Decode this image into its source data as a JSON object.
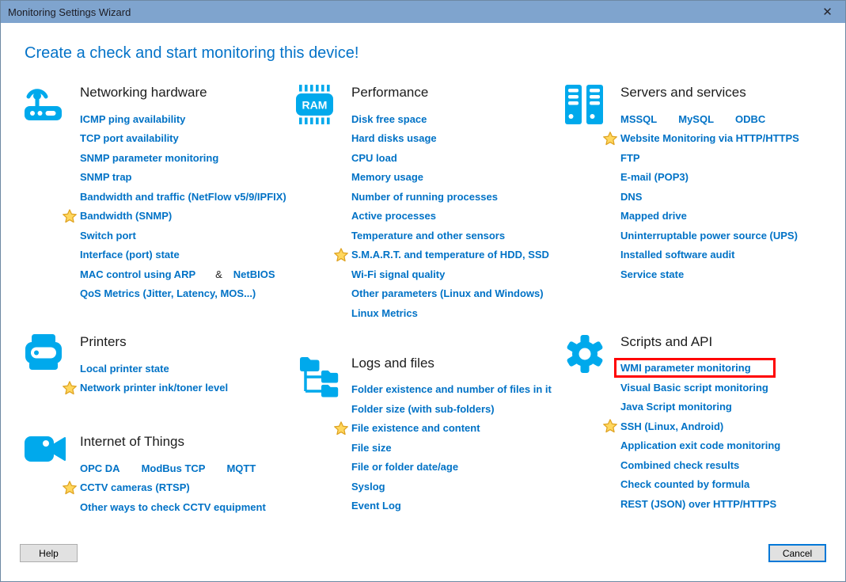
{
  "window": {
    "title": "Monitoring Settings Wizard",
    "close_glyph": "✕"
  },
  "heading": "Create a check and start monitoring this device!",
  "colors": {
    "icon_blue": "#00a9ec",
    "link_blue": "#0072c6",
    "titlebar_blue": "#7fa4ce",
    "heading_blue": "#0473c8",
    "highlight_red": "#ff0000",
    "star_gold": "#ffd75e"
  },
  "footer": {
    "help_label": "Help",
    "cancel_label": "Cancel"
  },
  "columns": [
    {
      "sections": [
        {
          "icon": "router-icon",
          "title": "Networking hardware",
          "items": [
            {
              "label": "ICMP ping availability"
            },
            {
              "label": "TCP port availability"
            },
            {
              "label": "SNMP parameter monitoring"
            },
            {
              "label": "SNMP trap"
            },
            {
              "label": "Bandwidth and traffic (NetFlow v5/9/IPFIX)"
            },
            {
              "label": "Bandwidth (SNMP)",
              "star": true
            },
            {
              "label": "Switch port"
            },
            {
              "label": "Interface (port) state"
            },
            {
              "links": [
                "MAC control using ARP",
                "NetBIOS"
              ],
              "separator": "&"
            },
            {
              "label": "QoS Metrics (Jitter, Latency, MOS...)"
            }
          ]
        },
        {
          "icon": "printer-icon",
          "title": "Printers",
          "items": [
            {
              "label": "Local printer state"
            },
            {
              "label": "Network printer ink/toner level",
              "star": true
            }
          ]
        },
        {
          "icon": "camera-icon",
          "title": "Internet of Things",
          "items": [
            {
              "links": [
                "OPC DA",
                "ModBus TCP",
                "MQTT"
              ]
            },
            {
              "label": "CCTV cameras (RTSP)",
              "star": true
            },
            {
              "label": "Other ways to check CCTV equipment"
            }
          ]
        }
      ]
    },
    {
      "sections": [
        {
          "icon": "ram-icon",
          "title": "Performance",
          "items": [
            {
              "label": "Disk free space"
            },
            {
              "label": "Hard disks usage"
            },
            {
              "label": "CPU load"
            },
            {
              "label": "Memory usage"
            },
            {
              "label": "Number of running processes"
            },
            {
              "label": "Active processes"
            },
            {
              "label": "Temperature and other sensors"
            },
            {
              "label": "S.M.A.R.T. and temperature of HDD, SSD",
              "star": true
            },
            {
              "label": "Wi-Fi signal quality"
            },
            {
              "label": "Other parameters (Linux and Windows)"
            },
            {
              "label": "Linux Metrics"
            }
          ]
        },
        {
          "icon": "folders-icon",
          "title": "Logs and files",
          "items": [
            {
              "label": "Folder existence and number of files in it"
            },
            {
              "label": "Folder size (with sub-folders)"
            },
            {
              "label": "File existence and content",
              "star": true
            },
            {
              "label": "File size"
            },
            {
              "label": "File or folder date/age"
            },
            {
              "label": "Syslog"
            },
            {
              "label": "Event Log"
            }
          ]
        }
      ]
    },
    {
      "sections": [
        {
          "icon": "servers-icon",
          "title": "Servers and services",
          "items": [
            {
              "links": [
                "MSSQL",
                "MySQL",
                "ODBC"
              ]
            },
            {
              "label": "Website Monitoring via HTTP/HTTPS",
              "star": true
            },
            {
              "label": "FTP"
            },
            {
              "label": "E-mail (POP3)"
            },
            {
              "label": "DNS"
            },
            {
              "label": "Mapped drive"
            },
            {
              "label": "Uninterruptable power source (UPS)"
            },
            {
              "label": "Installed software audit"
            },
            {
              "label": "Service state"
            }
          ]
        },
        {
          "icon": "gear-icon",
          "title": "Scripts and API",
          "items": [
            {
              "label": "WMI parameter monitoring",
              "highlighted": true
            },
            {
              "label": "Visual Basic script monitoring"
            },
            {
              "label": "Java Script monitoring"
            },
            {
              "label": "SSH (Linux, Android)",
              "star": true
            },
            {
              "label": "Application exit code monitoring"
            },
            {
              "label": "Combined check results"
            },
            {
              "label": "Check counted by formula"
            },
            {
              "label": "REST (JSON) over HTTP/HTTPS"
            }
          ]
        }
      ]
    }
  ]
}
